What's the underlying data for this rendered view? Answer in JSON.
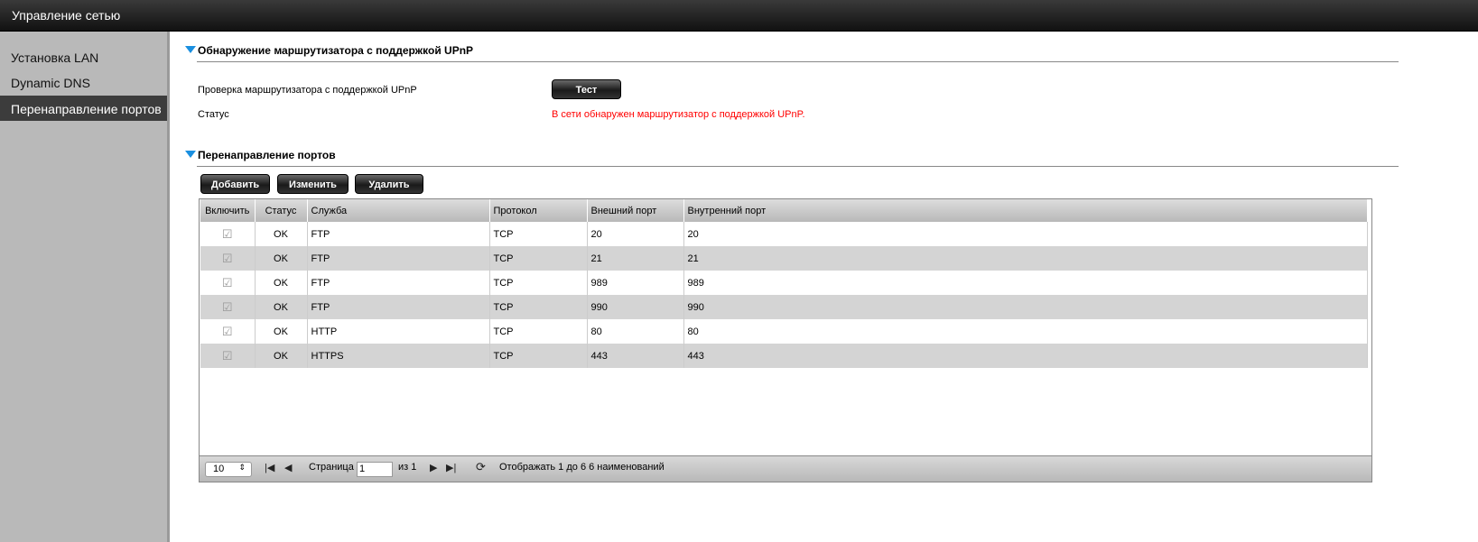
{
  "header": {
    "title": "Управление сетью"
  },
  "sidebar": {
    "items": [
      {
        "label": "Установка LAN"
      },
      {
        "label": "Dynamic DNS"
      },
      {
        "label": "Перенаправление портов"
      }
    ]
  },
  "upnp": {
    "title": "Обнаружение маршрутизатора с поддержкой UPnP",
    "check_label": "Проверка маршрутизатора с поддержкой UPnP",
    "test_button": "Тест",
    "status_label": "Статус",
    "status_value": "В сети обнаружен маршрутизатор с поддержкой UPnP.",
    "status_color": "#ff0000"
  },
  "forwarding": {
    "title": "Перенаправление портов",
    "add_button": "Добавить",
    "edit_button": "Изменить",
    "delete_button": "Удалить",
    "columns": [
      "Включить",
      "Статус",
      "Служба",
      "Протокол",
      "Внешний порт",
      "Внутренний порт"
    ],
    "rows": [
      {
        "enabled": true,
        "status": "OK",
        "service": "FTP",
        "protocol": "TCP",
        "ext": "20",
        "int": "20"
      },
      {
        "enabled": true,
        "status": "OK",
        "service": "FTP",
        "protocol": "TCP",
        "ext": "21",
        "int": "21"
      },
      {
        "enabled": true,
        "status": "OK",
        "service": "FTP",
        "protocol": "TCP",
        "ext": "989",
        "int": "989"
      },
      {
        "enabled": true,
        "status": "OK",
        "service": "FTP",
        "protocol": "TCP",
        "ext": "990",
        "int": "990"
      },
      {
        "enabled": true,
        "status": "OK",
        "service": "HTTP",
        "protocol": "TCP",
        "ext": "80",
        "int": "80"
      },
      {
        "enabled": true,
        "status": "OK",
        "service": "HTTPS",
        "protocol": "TCP",
        "ext": "443",
        "int": "443"
      }
    ],
    "pager": {
      "page_size": "10",
      "page_label": "Страница",
      "page_value": "1",
      "of_label": "из 1",
      "summary": "Отображать 1 до 6 6 наименований"
    }
  }
}
